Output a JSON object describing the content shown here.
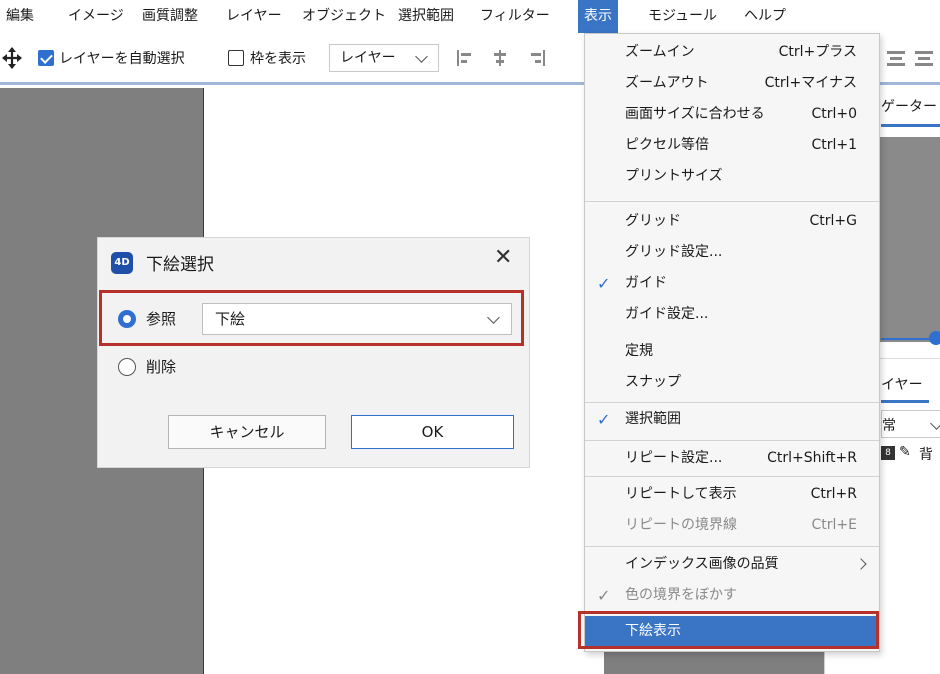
{
  "menubar": {
    "items": [
      "編集",
      "イメージ",
      "画質調整",
      "レイヤー",
      "オブジェクト",
      "選択範囲",
      "フィルター",
      "表示",
      "モジュール",
      "ヘルプ"
    ],
    "active_index": 7
  },
  "toolbar": {
    "move_icon": "move-arrows-icon",
    "auto_select_label": "レイヤーを自動選択",
    "auto_select_checked": true,
    "show_frame_label": "枠を表示",
    "show_frame_checked": false,
    "target_select_value": "レイヤー"
  },
  "right_panel": {
    "navigator_tab": "ゲーター",
    "layer_tab": "イヤー",
    "blend_fragment": "常",
    "layer_name_fragment": "背"
  },
  "dialog": {
    "title": "下絵選択",
    "icon_text": "4D",
    "close_glyph": "✕",
    "option_reference": "参照",
    "option_reference_selected": true,
    "reference_value": "下絵",
    "option_delete": "削除",
    "cancel_label": "キャンセル",
    "ok_label": "OK"
  },
  "view_menu": {
    "items": [
      {
        "label": "ズームイン",
        "shortcut": "Ctrl+プラス"
      },
      {
        "label": "ズームアウト",
        "shortcut": "Ctrl+マイナス"
      },
      {
        "label": "画面サイズに合わせる",
        "shortcut": "Ctrl+0"
      },
      {
        "label": "ピクセル等倍",
        "shortcut": "Ctrl+1"
      },
      {
        "label": "プリントサイズ",
        "shortcut": ""
      },
      {
        "label": "グリッド",
        "shortcut": "Ctrl+G"
      },
      {
        "label": "グリッド設定...",
        "shortcut": ""
      },
      {
        "label": "ガイド",
        "shortcut": "",
        "checked": true
      },
      {
        "label": "ガイド設定...",
        "shortcut": ""
      },
      {
        "label": "定規",
        "shortcut": ""
      },
      {
        "label": "スナップ",
        "shortcut": ""
      },
      {
        "label": "選択範囲",
        "shortcut": "",
        "checked": true
      },
      {
        "label": "リピート設定...",
        "shortcut": "Ctrl+Shift+R"
      },
      {
        "label": "リピートして表示",
        "shortcut": "Ctrl+R"
      },
      {
        "label": "リピートの境界線",
        "shortcut": "Ctrl+E",
        "disabled": true
      },
      {
        "label": "インデックス画像の品質",
        "shortcut": "",
        "submenu": true
      },
      {
        "label": "色の境界をぼかす",
        "shortcut": "",
        "checked": true,
        "disabled": true
      },
      {
        "label": "下絵表示",
        "shortcut": "",
        "selected": true
      }
    ],
    "check_glyph": "✓"
  },
  "colors": {
    "accent": "#3a74c4",
    "highlight_border": "#b8302a",
    "canvas_gray": "#7f7f7f"
  }
}
